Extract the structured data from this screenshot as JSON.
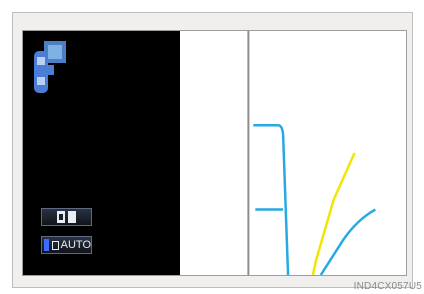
{
  "screen": {
    "buttons": {
      "auto_label": "AUTO"
    }
  },
  "caption": "IND4CX057U5",
  "icons": {
    "vehicle": "vehicle-top-view-icon",
    "split_view": "split-view-icon",
    "auto": "auto-mode-icon"
  },
  "colors": {
    "guide_blue": "#27a9e1",
    "guide_yellow": "#f2e600",
    "divider_gray": "#8c8c8c",
    "panel_black": "#000000"
  }
}
